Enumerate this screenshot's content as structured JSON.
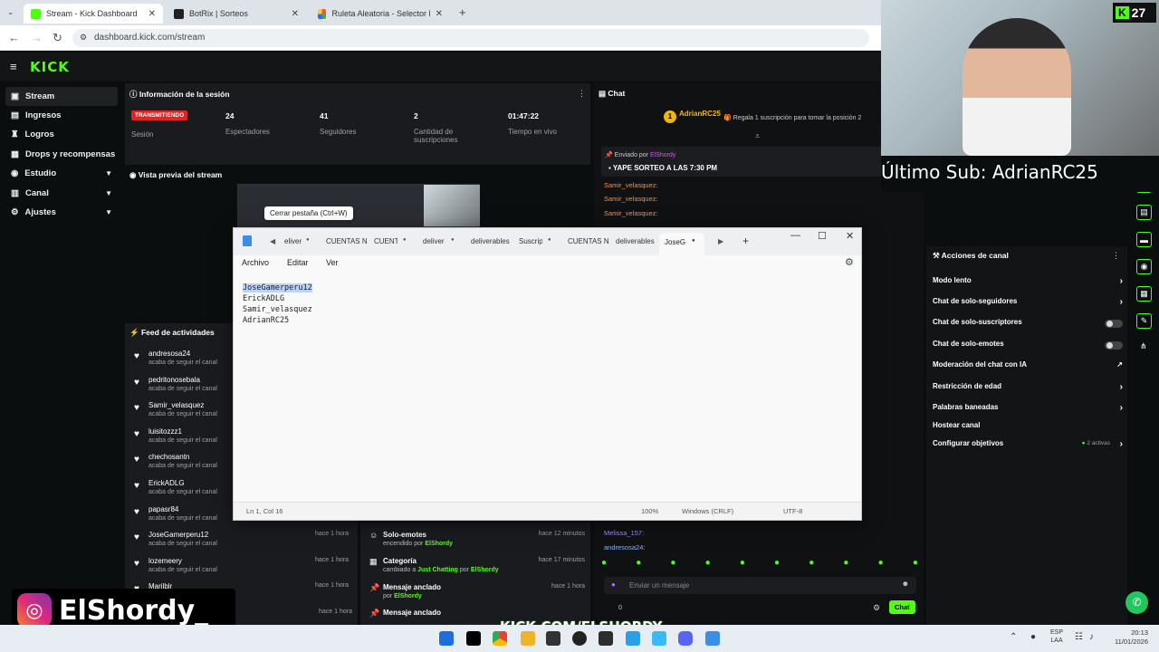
{
  "browser": {
    "tabs": [
      {
        "title": "Stream - Kick Dashboard",
        "fav": "#53fc18"
      },
      {
        "title": "BotRix | Sorteos",
        "fav": "#222"
      },
      {
        "title": "Ruleta Aleatoria - Selector Pers",
        "fav": "#e54"
      }
    ],
    "url": "dashboard.kick.com/stream"
  },
  "kick": {
    "logo": "KICK",
    "sidebar": [
      {
        "label": "Stream",
        "icon": "video-icon"
      },
      {
        "label": "Ingresos",
        "icon": "money-icon"
      },
      {
        "label": "Logros",
        "icon": "trophy-icon"
      },
      {
        "label": "Drops y recompensas",
        "icon": "gift-icon"
      },
      {
        "label": "Estudio",
        "icon": "camera-icon"
      },
      {
        "label": "Canal",
        "icon": "channel-icon"
      },
      {
        "label": "Ajustes",
        "icon": "gear-icon"
      }
    ],
    "session": {
      "title": "Información de la sesión",
      "live_badge": "TRANSMITIENDO",
      "session_label": "Sesión",
      "stats": [
        {
          "value": "24",
          "label": "Espectadores"
        },
        {
          "value": "41",
          "label": "Seguidores"
        },
        {
          "value": "2",
          "label": "Cantidad de suscripciones"
        },
        {
          "value": "01:47:22",
          "label": "Tiempo en vivo"
        }
      ]
    },
    "preview": {
      "title": "Vista previa del stream",
      "tooltip": "Cerrar pestaña (Ctrl+W)"
    },
    "feed": {
      "title": "Feed de actividades",
      "items": [
        {
          "name": "andresosa24",
          "sub": "acaba de seguir el canal",
          "time": ""
        },
        {
          "name": "pedritonosebala",
          "sub": "acaba de seguir el canal",
          "time": ""
        },
        {
          "name": "Samir_velasquez",
          "sub": "acaba de seguir el canal",
          "time": ""
        },
        {
          "name": "luisitozzz1",
          "sub": "acaba de seguir el canal",
          "time": ""
        },
        {
          "name": "chechosantn",
          "sub": "acaba de seguir el canal",
          "time": ""
        },
        {
          "name": "ErickADLG",
          "sub": "acaba de seguir el canal",
          "time": ""
        },
        {
          "name": "papasr84",
          "sub": "acaba de seguir el canal",
          "time": ""
        },
        {
          "name": "JoseGamerperu12",
          "sub": "acaba de seguir el canal",
          "time": "hace 1 hora"
        },
        {
          "name": "lozemeery",
          "sub": "acaba de seguir el canal",
          "time": "hace 1 hora"
        },
        {
          "name": "Marilblr",
          "sub": "",
          "time": "hace 1 hora"
        }
      ],
      "last_time": "hace 1 hora"
    },
    "actions": [
      {
        "name": "Solo-emotes",
        "sub_pre": "encendido por",
        "sub_user": "ElShordy",
        "time": "hace 12 minutos",
        "icon": "emote-icon"
      },
      {
        "name": "Categoría",
        "sub_pre": "cambiado a",
        "sub_user": "Just Chatting",
        "sub_mid": "por",
        "sub_user2": "ElShordy",
        "time": "hace 17 minutos",
        "icon": "category-icon"
      },
      {
        "name": "Mensaje anclado",
        "sub_pre": "por",
        "sub_user": "ElShordy",
        "time": "hace 1 hora",
        "icon": "pin-icon"
      },
      {
        "name": "Mensaje anclado",
        "sub_pre": "",
        "sub_user": "",
        "time": "",
        "icon": "pin-icon"
      }
    ],
    "chat": {
      "title": "Chat",
      "top_user": "AdrianRC25",
      "top_badge": "1",
      "top_note": "Regala 1 suscripción para tomar la posición 2",
      "pinned_by": "Enviado por",
      "pinned_user": "ElShordy",
      "pinned_msg": "YAPE SORTEO A LAS 7:30 PM",
      "lines": [
        {
          "user": "Samir_velasquez:",
          "color": "#ff8c3a"
        },
        {
          "user": "Samir_velasquez:",
          "color": "#ff8c3a"
        },
        {
          "user": "Samir_velasquez:",
          "color": "#ff8c3a"
        }
      ],
      "bottom_lines": [
        {
          "user": "Melissa_157:",
          "color": "#a58cff"
        },
        {
          "user": "andresosa24:",
          "color": "#8cb4ff"
        }
      ],
      "count": "0",
      "placeholder": "Enviar un mensaje",
      "send_label": "Chat"
    },
    "canal": {
      "title": "Acciones de canal",
      "rows": [
        {
          "label": "Modo lento",
          "ctrl": "chevron"
        },
        {
          "label": "Chat de solo-seguidores",
          "ctrl": "chevron"
        },
        {
          "label": "Chat de solo-suscriptores",
          "ctrl": "toggle"
        },
        {
          "label": "Chat de solo-emotes",
          "ctrl": "toggle"
        },
        {
          "label": "Moderación del chat con IA",
          "ctrl": "ext"
        },
        {
          "label": "Restricción de edad",
          "ctrl": "chevron"
        },
        {
          "label": "Palabras baneadas",
          "ctrl": "chevron"
        },
        {
          "label": "Hostear canal",
          "ctrl": "none"
        },
        {
          "label": "Configurar objetivos",
          "ctrl": "chevron"
        }
      ],
      "objetivos_badge": "2 activas"
    }
  },
  "notepad": {
    "tabs": [
      "eliver",
      "CUENTAS NI",
      "CUENT",
      "deliver",
      "deliverables",
      "Suscrip",
      "CUENTAS NI",
      "deliverables",
      "JoseG"
    ],
    "menu": [
      "Archivo",
      "Editar",
      "Ver"
    ],
    "lines": [
      "JoseGamerperu12",
      "ErickADLG",
      "Samir_velasquez",
      "AdrianRC25"
    ],
    "status": {
      "pos": "Ln 1, Col 16",
      "zoom": "100%",
      "eol": "Windows (CRLF)",
      "enc": "UTF-8"
    }
  },
  "overlay": {
    "last_sub": "Último Sub: AdrianRC25",
    "corner_count": "27",
    "social_name": "ElShordy_",
    "kick_url": "KICK.COM/ELSHORDY"
  },
  "taskbar": {
    "lang1": "ESP",
    "lang2": "LAA",
    "time": "20:13",
    "date": "11/01/2026"
  }
}
